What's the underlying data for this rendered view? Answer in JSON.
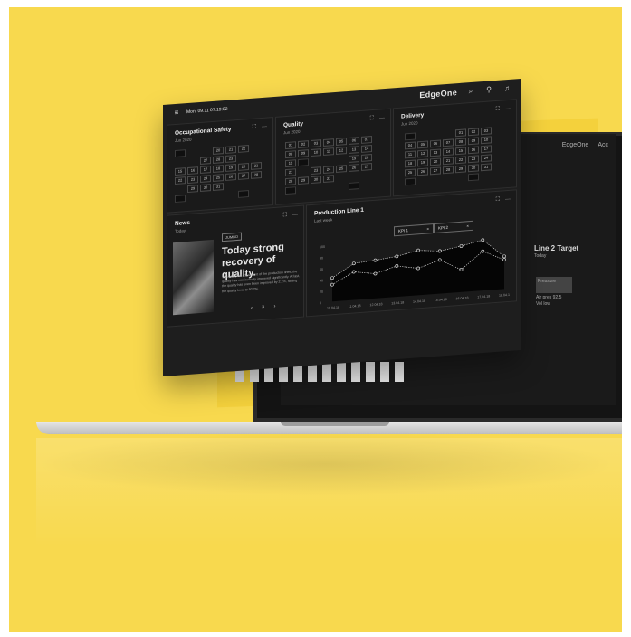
{
  "background_color": "#f8d94e",
  "topbar": {
    "brand": "EdgeOne",
    "date_label": "Mon, 09.11 07:19:02",
    "icons": [
      "menu-icon",
      "search-icon",
      "filter-icon",
      "bell-icon"
    ]
  },
  "back_dashboard": {
    "title": "Line 2 Target",
    "subtitle": "Today",
    "chip_lines": [
      "Pressure",
      "Air pres 92.5",
      "Vol low"
    ],
    "topbar_brand": "EdgeOne",
    "top_right_label": "Acc"
  },
  "occupational_safety": {
    "title": "Occupational Safety",
    "subtitle": "Jun 2020",
    "days": [
      "",
      "",
      "",
      "20",
      "21",
      "22",
      "",
      "",
      "",
      "27",
      "28",
      "23",
      "",
      "",
      "15",
      "16",
      "17",
      "18",
      "19",
      "20",
      "21",
      "22",
      "23",
      "24",
      "25",
      "26",
      "27",
      "28",
      "",
      "29",
      "30",
      "31",
      "",
      "",
      "",
      "",
      "",
      "",
      "",
      "",
      "",
      ""
    ]
  },
  "quality": {
    "title": "Quality",
    "subtitle": "Jun 2020",
    "days": [
      "01",
      "02",
      "03",
      "04",
      "05",
      "06",
      "07",
      "08",
      "09",
      "10",
      "11",
      "12",
      "13",
      "14",
      "15",
      "",
      "",
      "",
      "",
      "19",
      "20",
      "21",
      "",
      "23",
      "24",
      "25",
      "26",
      "27",
      "28",
      "29",
      "30",
      "31",
      "",
      "",
      "",
      "",
      "",
      "",
      "",
      "",
      "",
      ""
    ]
  },
  "delivery": {
    "title": "Delivery",
    "subtitle": "Jun 2020",
    "days": [
      "",
      "",
      "",
      "",
      "01",
      "02",
      "03",
      "04",
      "05",
      "06",
      "07",
      "08",
      "09",
      "10",
      "11",
      "12",
      "13",
      "14",
      "15",
      "16",
      "17",
      "18",
      "19",
      "20",
      "21",
      "22",
      "23",
      "24",
      "25",
      "26",
      "27",
      "28",
      "29",
      "30",
      "31",
      "",
      "",
      "",
      "",
      "",
      "",
      ""
    ]
  },
  "news": {
    "title": "News",
    "subtitle": "Today",
    "badge": "JUMBO",
    "headline": "Today strong recovery of quality.",
    "body": "Since the last adjustment of the production lines, the quality has continuously improved significantly. At last, the quality has even been improved by 2.1%, raising the quality level to 92.2%.",
    "nav_prev": "‹",
    "nav_close": "×",
    "nav_next": "›"
  },
  "production": {
    "title": "Production Line 1",
    "subtitle": "Last week",
    "kpi_1": "KPI 1",
    "kpi_2": "KPI 2"
  },
  "chart_data": {
    "type": "line",
    "title": "Production Line 1",
    "x": [
      "10.04.18",
      "11.04.18",
      "12.04.18",
      "13.04.18",
      "14.04.18",
      "15.04.18",
      "16.04.18",
      "17.04.18",
      "18.04.18"
    ],
    "series": [
      {
        "name": "KPI 1",
        "values": [
          42,
          65,
          68,
          72,
          80,
          76,
          82,
          90,
          58
        ]
      },
      {
        "name": "KPI 2",
        "values": [
          30,
          50,
          44,
          55,
          48,
          60,
          40,
          70,
          52
        ]
      }
    ],
    "ylim": [
      0,
      100
    ],
    "yticks": [
      "100",
      "80",
      "60",
      "40",
      "20",
      "0"
    ]
  },
  "ghost_bars_count": 12
}
